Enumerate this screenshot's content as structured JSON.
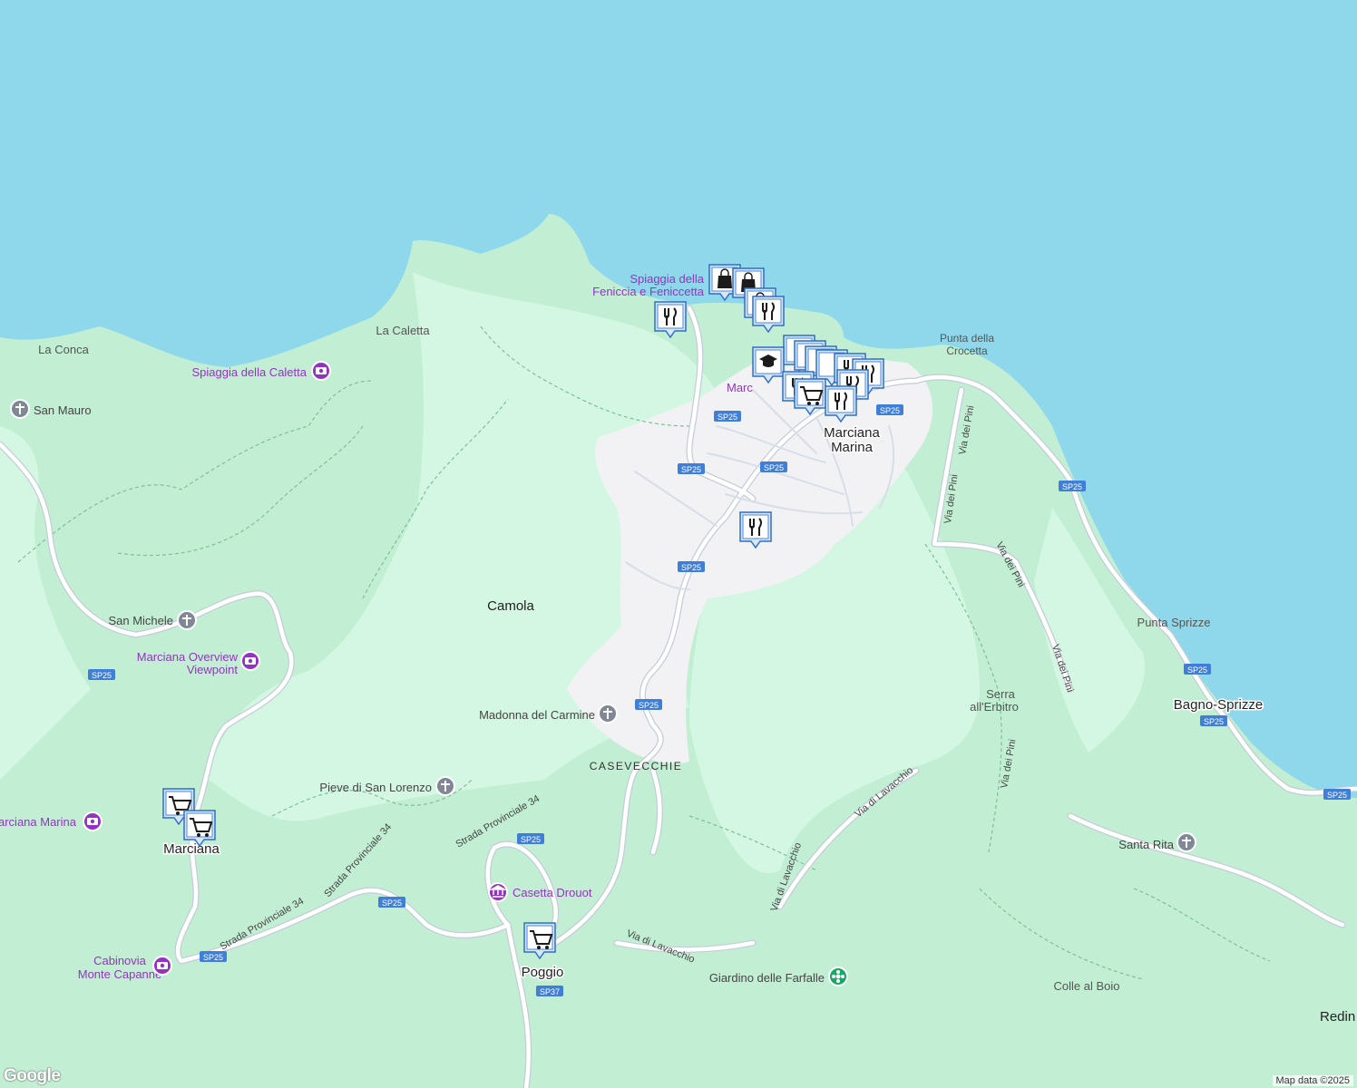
{
  "colors": {
    "sea": "#8fd8ec",
    "land_dark": "#c2efd4",
    "land_light": "#d4f7e3",
    "urban": "#f2f2f4",
    "road": "#ffffff",
    "road_edge": "#c4ccd8",
    "poi_purple": "#9334c0",
    "pin_fill": "#d7e7fb",
    "pin_stroke": "#2f6fc4",
    "route_badge": "#3f7fd8"
  },
  "places": {
    "marciana_marina": "Marciana Marina",
    "marciana": "Marciana",
    "marciana_clipped": "Marc",
    "poggio": "Poggio",
    "camola": "Camola",
    "casevecchie": "CASEVECCHIE",
    "bagno_sprizze": "Bagno-Sprizze",
    "redin": "Redin",
    "la_caletta": "La Caletta",
    "la_conca": "La Conca",
    "san_mauro": "San Mauro",
    "san_michele": "San Michele",
    "punta_crocetta": "Punta della Crocetta",
    "punta_sprizze": "Punta Sprizze",
    "serra_erbitro": "Serra all'Erbitro",
    "colle_boio": "Colle al Boio",
    "santa_rita": "Santa Rita",
    "madonna_carmine": "Madonna del Carmine",
    "pieve_san_lorenzo": "Pieve di San Lorenzo",
    "giardino_farfalle": "Giardino delle Farfalle"
  },
  "poi": {
    "feniccia": "Spiaggia della Feniccia e Fenicetta",
    "caletta_beach": "Spiaggia della Caletta",
    "overview": "Marciana Overview Viewpoint",
    "marciana_marina_west": "arciana Marina",
    "cabinovia": "Cabinovia Monte Capanne",
    "casetta": "Casetta Drouot"
  },
  "roads": {
    "sp25": "SP25",
    "sp37": "SP37",
    "via_pini": "Via dei Pini",
    "via_lavacchio": "Via di Lavacchio",
    "strada_34": "Strada Provinciale 34"
  },
  "footer": {
    "attribution": "Map data ©2025",
    "logo": "Google"
  }
}
